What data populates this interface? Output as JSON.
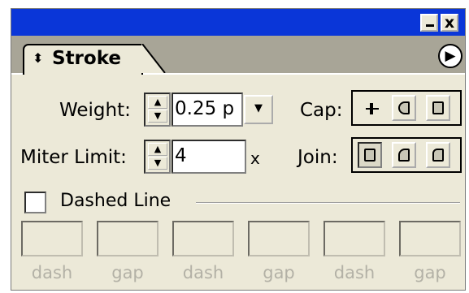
{
  "titlebar": {
    "close_glyph": "x"
  },
  "tab": {
    "label": "Stroke",
    "sort_icon": "sort-updown-icon"
  },
  "menu_glyph": "▶",
  "weight": {
    "label": "Weight:",
    "value": "0.25 p"
  },
  "cap": {
    "label": "Cap:"
  },
  "miter": {
    "label": "Miter Limit:",
    "value": "4",
    "suffix": "x"
  },
  "join": {
    "label": "Join:"
  },
  "dashed": {
    "label": "Dashed Line",
    "checked": false
  },
  "dash_fields": [
    {
      "label": "dash"
    },
    {
      "label": "gap"
    },
    {
      "label": "dash"
    },
    {
      "label": "gap"
    },
    {
      "label": "dash"
    },
    {
      "label": "gap"
    }
  ]
}
